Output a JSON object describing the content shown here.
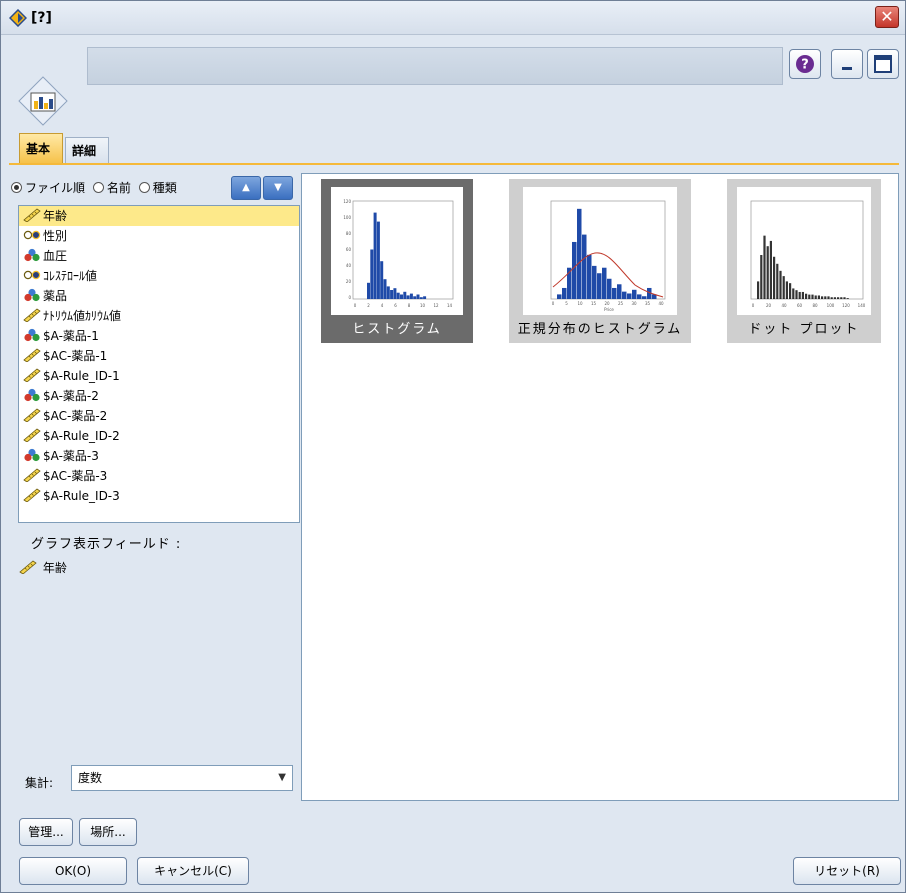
{
  "window": {
    "title": "[?]"
  },
  "header": {
    "name_value": ""
  },
  "tabs": [
    {
      "label": "基本"
    },
    {
      "label": "詳細"
    }
  ],
  "sort": {
    "options": [
      "ファイル順",
      "名前",
      "種類"
    ],
    "selected": "ファイル順"
  },
  "fields": [
    {
      "label": "年齢",
      "type": "continuous"
    },
    {
      "label": "性別",
      "type": "flag"
    },
    {
      "label": "血圧",
      "type": "nominal"
    },
    {
      "label": "ｺﾚｽﾃﾛｰﾙ値",
      "type": "flag"
    },
    {
      "label": "薬品",
      "type": "nominal"
    },
    {
      "label": "ﾅﾄﾘｳﾑ値ｶﾘｳﾑ値",
      "type": "continuous"
    },
    {
      "label": "$A-薬品-1",
      "type": "nominal"
    },
    {
      "label": "$AC-薬品-1",
      "type": "continuous"
    },
    {
      "label": "$A-Rule_ID-1",
      "type": "continuous"
    },
    {
      "label": "$A-薬品-2",
      "type": "nominal"
    },
    {
      "label": "$AC-薬品-2",
      "type": "continuous"
    },
    {
      "label": "$A-Rule_ID-2",
      "type": "continuous"
    },
    {
      "label": "$A-薬品-3",
      "type": "nominal"
    },
    {
      "label": "$AC-薬品-3",
      "type": "continuous"
    },
    {
      "label": "$A-Rule_ID-3",
      "type": "continuous"
    }
  ],
  "graph_fields_label": "グラフ表示フィールド :",
  "graph_field": "年齢",
  "aggregate": {
    "label": "集計:",
    "value": "度数"
  },
  "graphs": [
    {
      "label": "ヒストグラム"
    },
    {
      "label": "正規分布のヒストグラム"
    },
    {
      "label": "ドット プロット"
    }
  ],
  "thumb_ticks": {
    "hist_y": [
      "120",
      "100",
      "80",
      "60",
      "40",
      "20",
      "0"
    ],
    "hist_x": [
      "0",
      "2",
      "4",
      "6",
      "8",
      "10",
      "12",
      "14"
    ],
    "normal_x": [
      "0",
      "5",
      "10",
      "15",
      "20",
      "25",
      "30",
      "35",
      "40"
    ],
    "normal_xlabel": "Price",
    "dot_x": [
      "0",
      "20",
      "40",
      "60",
      "80",
      "100",
      "120",
      "140"
    ]
  },
  "buttons": {
    "manage": "管理...",
    "location": "場所...",
    "ok": "OK(O)",
    "cancel": "キャンセル(C)",
    "reset": "リセット(R)"
  },
  "colors": {
    "accent_tab": "#f6c24a",
    "bar": "#1f4aa8",
    "sort_button": "#3a6fc0"
  }
}
